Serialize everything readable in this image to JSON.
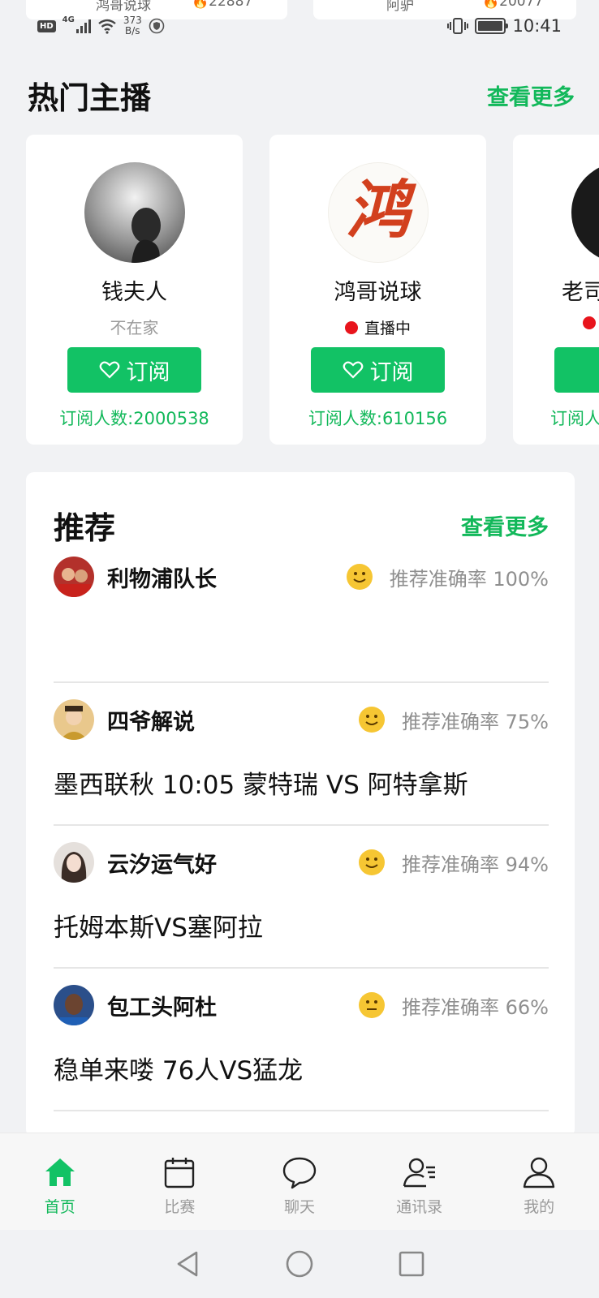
{
  "peek": {
    "left_name": "鸿哥说球",
    "left_count": "22887",
    "right_name": "阿驴",
    "right_count": "20077"
  },
  "status_bar": {
    "hd": "HD",
    "network": "4G",
    "speed_value": "373",
    "speed_unit": "B/s",
    "time": "10:41"
  },
  "hot_anchors": {
    "title": "热门主播",
    "more": "查看更多",
    "cards": [
      {
        "name": "钱夫人",
        "status": "不在家",
        "live": false,
        "subscribe": "订阅",
        "subscribers": "订阅人数:2000538"
      },
      {
        "name": "鸿哥说球",
        "status": "直播中",
        "live": true,
        "subscribe": "订阅",
        "subscribers": "订阅人数:610156",
        "avatar_glyph": "鸿"
      },
      {
        "name": "老司",
        "status": "",
        "live": true,
        "subscribe": "",
        "subscribers": "订阅人"
      }
    ]
  },
  "recommend": {
    "title": "推荐",
    "more": "查看更多",
    "items": [
      {
        "user": "利物浦队长",
        "rate": "推荐准确率 100%",
        "match": ""
      },
      {
        "user": "四爷解说",
        "rate": "推荐准确率 75%",
        "match": "墨西联秋 10:05 蒙特瑞 VS 阿特拿斯"
      },
      {
        "user": "云汐运气好",
        "rate": "推荐准确率 94%",
        "match": "托姆本斯VS塞阿拉"
      },
      {
        "user": "包工头阿杜",
        "rate": "推荐准确率 66%",
        "match": "稳单来喽 76人VS猛龙"
      }
    ]
  },
  "nav": {
    "items": [
      {
        "label": "首页",
        "icon": "home-icon",
        "active": true
      },
      {
        "label": "比赛",
        "icon": "calendar-icon",
        "active": false
      },
      {
        "label": "聊天",
        "icon": "chat-bubble-icon",
        "active": false
      },
      {
        "label": "通讯录",
        "icon": "contacts-icon",
        "active": false
      },
      {
        "label": "我的",
        "icon": "profile-icon",
        "active": false
      }
    ]
  },
  "colors": {
    "accent": "#12c265",
    "accent_text": "#12b85a",
    "live_dot": "#e8141c",
    "background": "#f1f2f4"
  }
}
